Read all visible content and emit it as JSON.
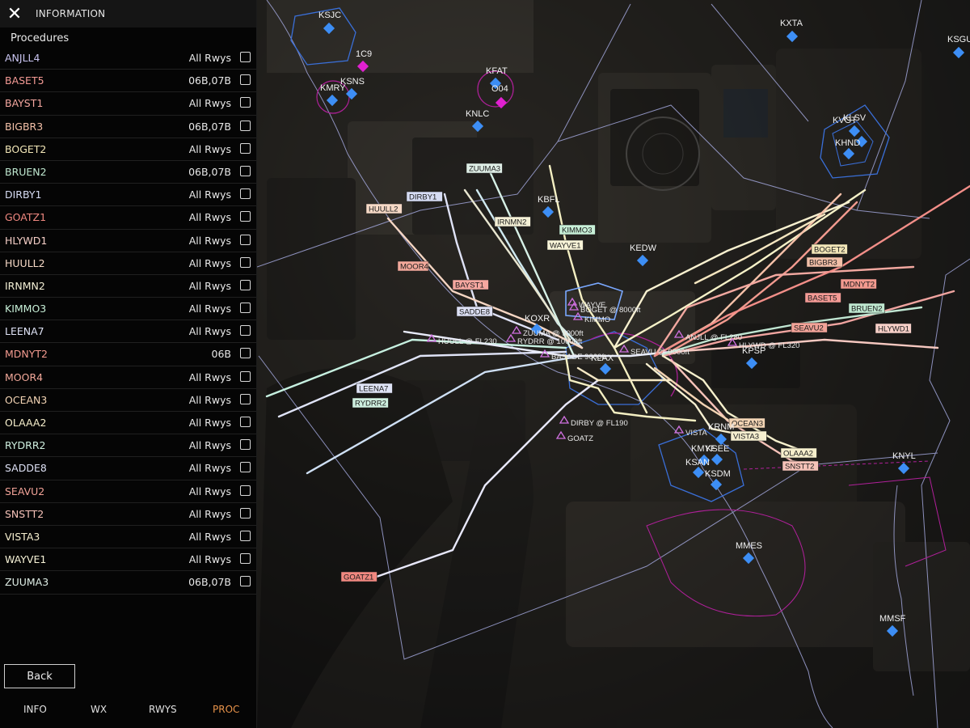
{
  "panel": {
    "title": "INFORMATION",
    "section": "Procedures",
    "back_label": "Back",
    "tabs": [
      {
        "label": "INFO",
        "color": "#e0e0e0"
      },
      {
        "label": "WX",
        "color": "#e0e0e0"
      },
      {
        "label": "RWYS",
        "color": "#e0e0e0"
      },
      {
        "label": "PROC",
        "color": "#e8934a"
      }
    ],
    "procedures": [
      {
        "name": "ANJLL4",
        "rwy": "All Rwys",
        "color": "#c9c4f0"
      },
      {
        "name": "BASET5",
        "rwy": "06B,07B",
        "color": "#f49a95"
      },
      {
        "name": "BAYST1",
        "rwy": "All Rwys",
        "color": "#f5a7a0"
      },
      {
        "name": "BIGBR3",
        "rwy": "06B,07B",
        "color": "#f3c0a8"
      },
      {
        "name": "BOGET2",
        "rwy": "All Rwys",
        "color": "#f3e7b8"
      },
      {
        "name": "BRUEN2",
        "rwy": "06B,07B",
        "color": "#bfe8d0"
      },
      {
        "name": "DIRBY1",
        "rwy": "All Rwys",
        "color": "#d6dcf4"
      },
      {
        "name": "GOATZ1",
        "rwy": "All Rwys",
        "color": "#f08880"
      },
      {
        "name": "HLYWD1",
        "rwy": "All Rwys",
        "color": "#f7d0c8"
      },
      {
        "name": "HUULL2",
        "rwy": "All Rwys",
        "color": "#f6d9c6"
      },
      {
        "name": "IRNMN2",
        "rwy": "All Rwys",
        "color": "#f4f0d6"
      },
      {
        "name": "KIMMO3",
        "rwy": "All Rwys",
        "color": "#c8f0d8"
      },
      {
        "name": "LEENA7",
        "rwy": "All Rwys",
        "color": "#dfe3f6"
      },
      {
        "name": "MDNYT2",
        "rwy": "06B",
        "color": "#f39a8f"
      },
      {
        "name": "MOOR4",
        "rwy": "All Rwys",
        "color": "#f2a89a"
      },
      {
        "name": "OCEAN3",
        "rwy": "All Rwys",
        "color": "#f3d4b4"
      },
      {
        "name": "OLAAA2",
        "rwy": "All Rwys",
        "color": "#f6efcc"
      },
      {
        "name": "RYDRR2",
        "rwy": "All Rwys",
        "color": "#cff0e0"
      },
      {
        "name": "SADDE8",
        "rwy": "All Rwys",
        "color": "#dde0f4"
      },
      {
        "name": "SEAVU2",
        "rwy": "All Rwys",
        "color": "#f2a398"
      },
      {
        "name": "SNSTT2",
        "rwy": "All Rwys",
        "color": "#f6c2b8"
      },
      {
        "name": "VISTA3",
        "rwy": "All Rwys",
        "color": "#f6efcf"
      },
      {
        "name": "WAYVE1",
        "rwy": "All Rwys",
        "color": "#f8f4d8"
      },
      {
        "name": "ZUUMA3",
        "rwy": "06B,07B",
        "color": "#dfeee6"
      }
    ]
  },
  "map": {
    "airports": [
      "KSJC",
      "KXTA",
      "KSGU",
      "1C9",
      "KFAT",
      "O04",
      "KMRY",
      "KSNS",
      "KNLC",
      "KVGT",
      "KLSV",
      "KHND",
      "KBFL",
      "KEDW",
      "KOXR",
      "KLAX",
      "KPSP",
      "KRNM",
      "KMYF",
      "KSAN",
      "KSEE",
      "KSDM",
      "KNYL",
      "MMES",
      "MMSF"
    ],
    "airport_labels": {
      "KSJC": "KSJC",
      "KXTA": "KXTA",
      "KSGU": "KSGU",
      "1C9": "1C9",
      "KFAT": "KFAT",
      "O04": "O04",
      "KMRY": "KMRY",
      "KSNS": "KSNS",
      "KNLC": "KNLC",
      "KVGT": "KVGT",
      "KLSV": "KLSV",
      "KHND": "KHND",
      "KBFL": "KBFL",
      "KEDW": "KEDW",
      "KOXR": "KOXR",
      "KLAX": "KLAX",
      "KPSP": "KPSP",
      "KRNM": "KRNM",
      "KMYF": "KMYF",
      "KSAN": "KSAN",
      "KSEE": "KSEE",
      "KSDM": "KSDM",
      "KNYL": "KNYL",
      "MMES": "MMES",
      "MMSF": "MMSF"
    },
    "route_tags": [
      "ZUUMA3",
      "DIRBY1",
      "HUULL2",
      "IRNMN2",
      "KIMMO3",
      "WAYVE1",
      "MOOR4",
      "BAYST1",
      "SADDE8",
      "LEENA7",
      "RYDRR2",
      "GOATZ1",
      "BOGET2",
      "BIGBR3",
      "MDNYT2",
      "BASET5",
      "BRUEN2",
      "SEAVU2",
      "HLYWD1",
      "OCEAN3",
      "VISTA3",
      "OLAAA2",
      "SNSTT2"
    ],
    "waypoint_labels": [
      "WAYVE",
      "BOGET @ 8000ft",
      "KIMMO",
      "HUULL @ FL230",
      "ZUUMA @ 9000ft",
      "RYDRR @ 10000ft",
      "ANJLL @ FL280",
      "HLYWD @ FL320",
      "BASADE 9000ft",
      "DIRBY @ FL190",
      "GOATZ",
      "VISTA",
      "SEAVU @ 9000ft"
    ],
    "colors": {
      "airport": "#3d8ef5",
      "heliport": "#e020d0",
      "airspace_blue": "#3a6fd8",
      "airspace_magenta": "#b0209a"
    }
  }
}
